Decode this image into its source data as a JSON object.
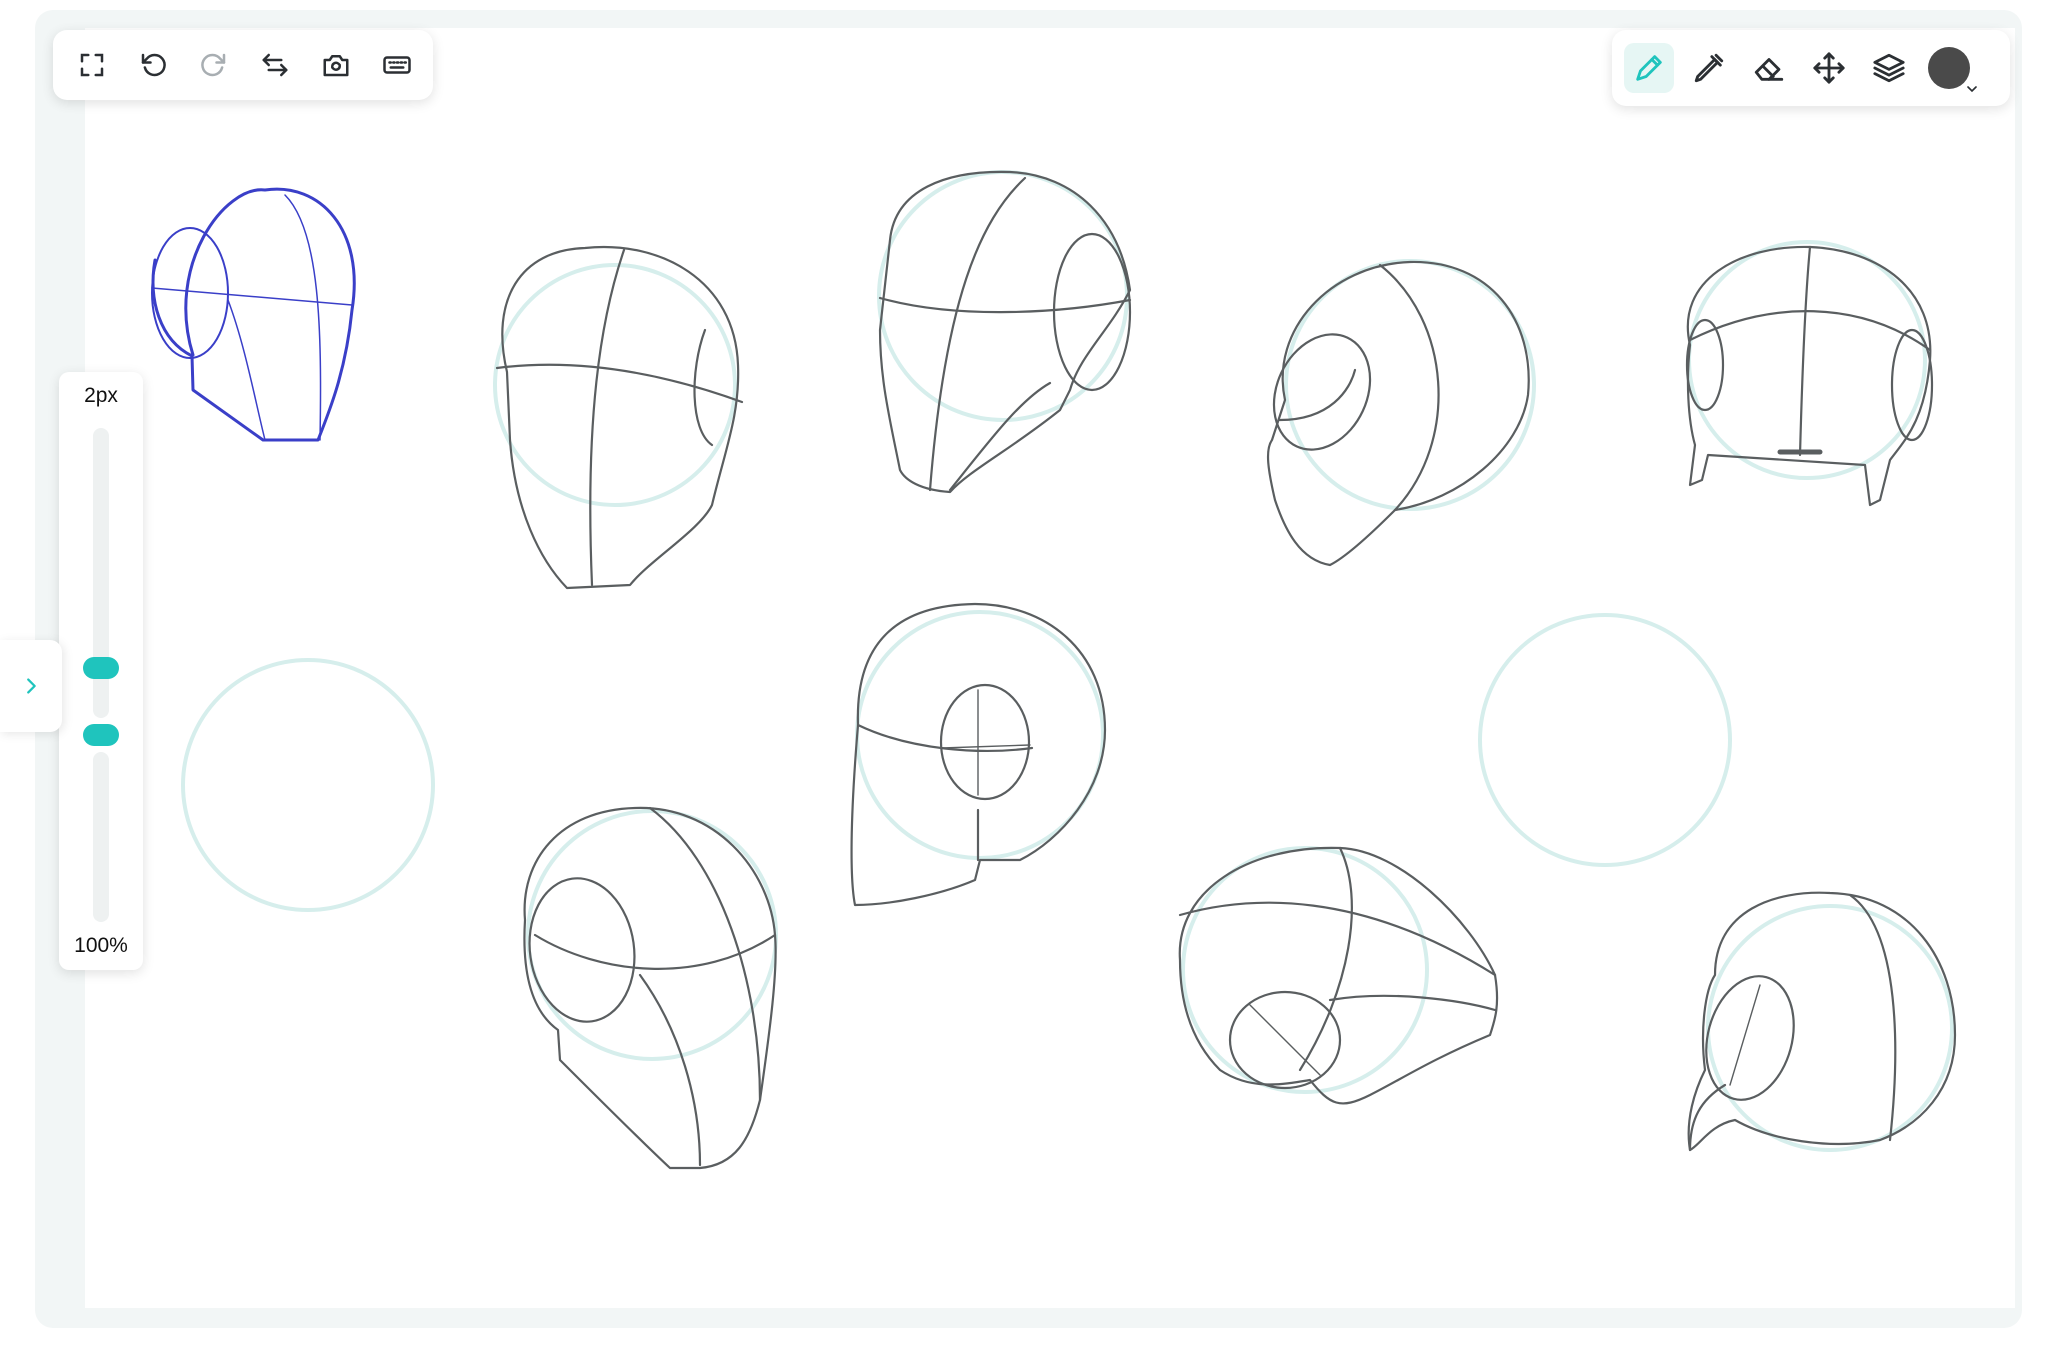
{
  "toolbar_left": {
    "tools": [
      {
        "name": "fullscreen-icon"
      },
      {
        "name": "undo-icon"
      },
      {
        "name": "redo-icon"
      },
      {
        "name": "swap-icon"
      },
      {
        "name": "camera-swap-icon"
      },
      {
        "name": "keyboard-icon"
      }
    ]
  },
  "toolbar_right": {
    "tools": [
      {
        "name": "pencil-icon",
        "active": true
      },
      {
        "name": "marker-icon",
        "active": false
      },
      {
        "name": "eraser-icon",
        "active": false
      },
      {
        "name": "move-icon",
        "active": false
      },
      {
        "name": "layers-icon",
        "active": false
      }
    ],
    "current_color": "#4a4a4a"
  },
  "brush": {
    "size_label": "2px",
    "opacity_label": "100%"
  },
  "colors": {
    "accent": "#1fc4bd",
    "active_bg": "#e6f6f4",
    "sketch": "#5a5e60",
    "guide": "#d6eeec",
    "highlight_stroke": "#3a3fc8"
  }
}
